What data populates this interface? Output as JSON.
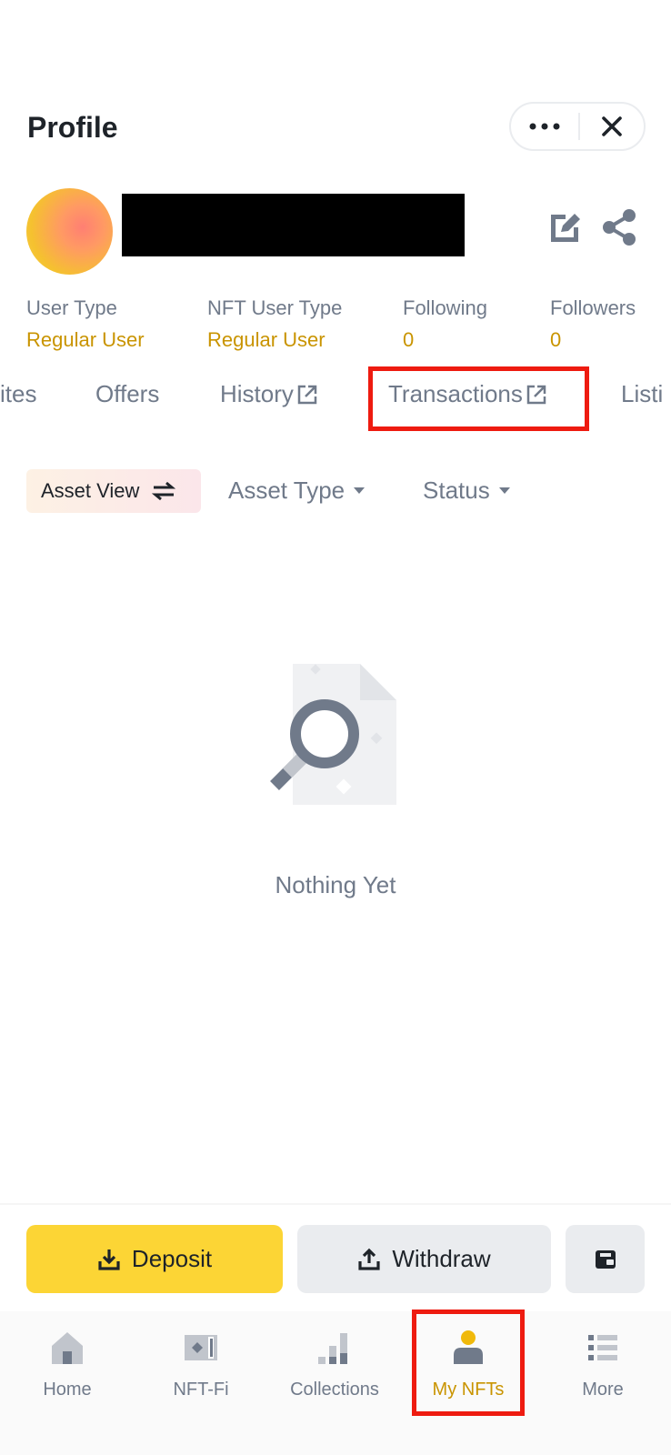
{
  "header": {
    "title": "Profile"
  },
  "stats": [
    {
      "label": "User Type",
      "value": "Regular User"
    },
    {
      "label": "NFT User Type",
      "value": "Regular User"
    },
    {
      "label": "Following",
      "value": "0"
    },
    {
      "label": "Followers",
      "value": "0"
    }
  ],
  "tabs": [
    {
      "label": "ites"
    },
    {
      "label": "Offers"
    },
    {
      "label": "History"
    },
    {
      "label": "Transactions"
    },
    {
      "label": "Listi"
    }
  ],
  "filters": {
    "asset_view": "Asset View",
    "asset_type": "Asset Type",
    "status": "Status"
  },
  "empty_state": {
    "text": "Nothing Yet"
  },
  "actions": {
    "deposit": "Deposit",
    "withdraw": "Withdraw"
  },
  "bottom_nav": [
    {
      "label": "Home"
    },
    {
      "label": "NFT-Fi"
    },
    {
      "label": "Collections"
    },
    {
      "label": "My NFTs"
    },
    {
      "label": "More"
    }
  ],
  "colors": {
    "accent": "#fcd535",
    "value_gold": "#c99400",
    "text_secondary": "#707a8a",
    "highlight_red": "#ee1b10"
  },
  "icons": [
    "more-icon",
    "close-icon",
    "edit-icon",
    "share-icon",
    "external-link-icon",
    "swap-icon",
    "caret-down-icon",
    "download-icon",
    "upload-icon",
    "wallet-icon",
    "home-icon",
    "nft-fi-icon",
    "collections-icon",
    "my-nfts-icon",
    "more-list-icon"
  ]
}
